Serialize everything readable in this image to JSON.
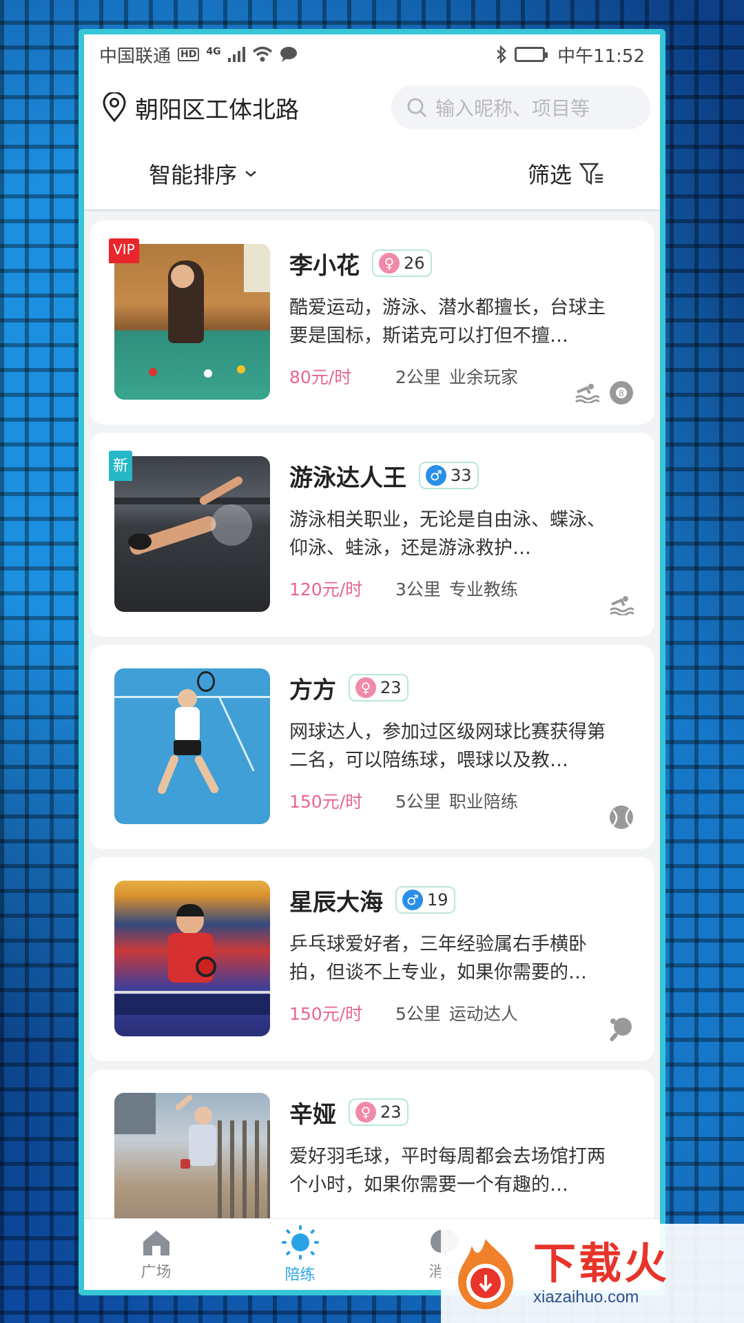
{
  "status": {
    "carrier": "中国联通",
    "hd": "HD",
    "network": "4G",
    "time": "中午11:52"
  },
  "header": {
    "location": "朝阳区工体北路",
    "search_placeholder": "输入昵称、项目等",
    "sort_label": "智能排序",
    "filter_label": "筛选"
  },
  "cards": [
    {
      "badge": "VIP",
      "name": "李小花",
      "gender": "female",
      "age": "26",
      "desc": "酷爱运动，游泳、潜水都擅长，台球主要是国标，斯诺克可以打但不擅…",
      "price": "80元/时",
      "distance": "2公里",
      "level": "业余玩家",
      "sports": [
        "swimming-icon",
        "billiards-icon"
      ]
    },
    {
      "badge": "新",
      "name": "游泳达人王",
      "gender": "male",
      "age": "33",
      "desc": "游泳相关职业，无论是自由泳、蝶泳、仰泳、蛙泳，还是游泳救护…",
      "price": "120元/时",
      "distance": "3公里",
      "level": "专业教练",
      "sports": [
        "swimming-icon"
      ]
    },
    {
      "badge": "",
      "name": "方方",
      "gender": "female",
      "age": "23",
      "desc": "网球达人，参加过区级网球比赛获得第二名，可以陪练球，喂球以及教…",
      "price": "150元/时",
      "distance": "5公里",
      "level": "职业陪练",
      "sports": [
        "tennis-icon"
      ]
    },
    {
      "badge": "",
      "name": "星辰大海",
      "gender": "male",
      "age": "19",
      "desc": "乒乓球爱好者，三年经验属右手横卧拍，但谈不上专业，如果你需要的…",
      "price": "150元/时",
      "distance": "5公里",
      "level": "运动达人",
      "sports": [
        "table-tennis-icon"
      ]
    },
    {
      "badge": "",
      "name": "辛娅",
      "gender": "female",
      "age": "23",
      "desc": "爱好羽毛球，平时每周都会去场馆打两个小时，如果你需要一个有趣的…",
      "price": "",
      "distance": "",
      "level": "",
      "sports": []
    }
  ],
  "tabs": [
    {
      "label": "广场",
      "icon": "home-icon",
      "active": false
    },
    {
      "label": "陪练",
      "icon": "sun-icon",
      "active": true
    },
    {
      "label": "消息",
      "icon": "message-icon",
      "active": false
    },
    {
      "label": "",
      "icon": "",
      "active": false
    }
  ],
  "watermark": {
    "cn": "下载火",
    "en": "xiazaihuo.com"
  },
  "colors": {
    "accent": "#2aa3e6",
    "price": "#e9658e",
    "vip": "#e8262b",
    "new": "#27b7c6",
    "frame": "#37c6d8"
  }
}
